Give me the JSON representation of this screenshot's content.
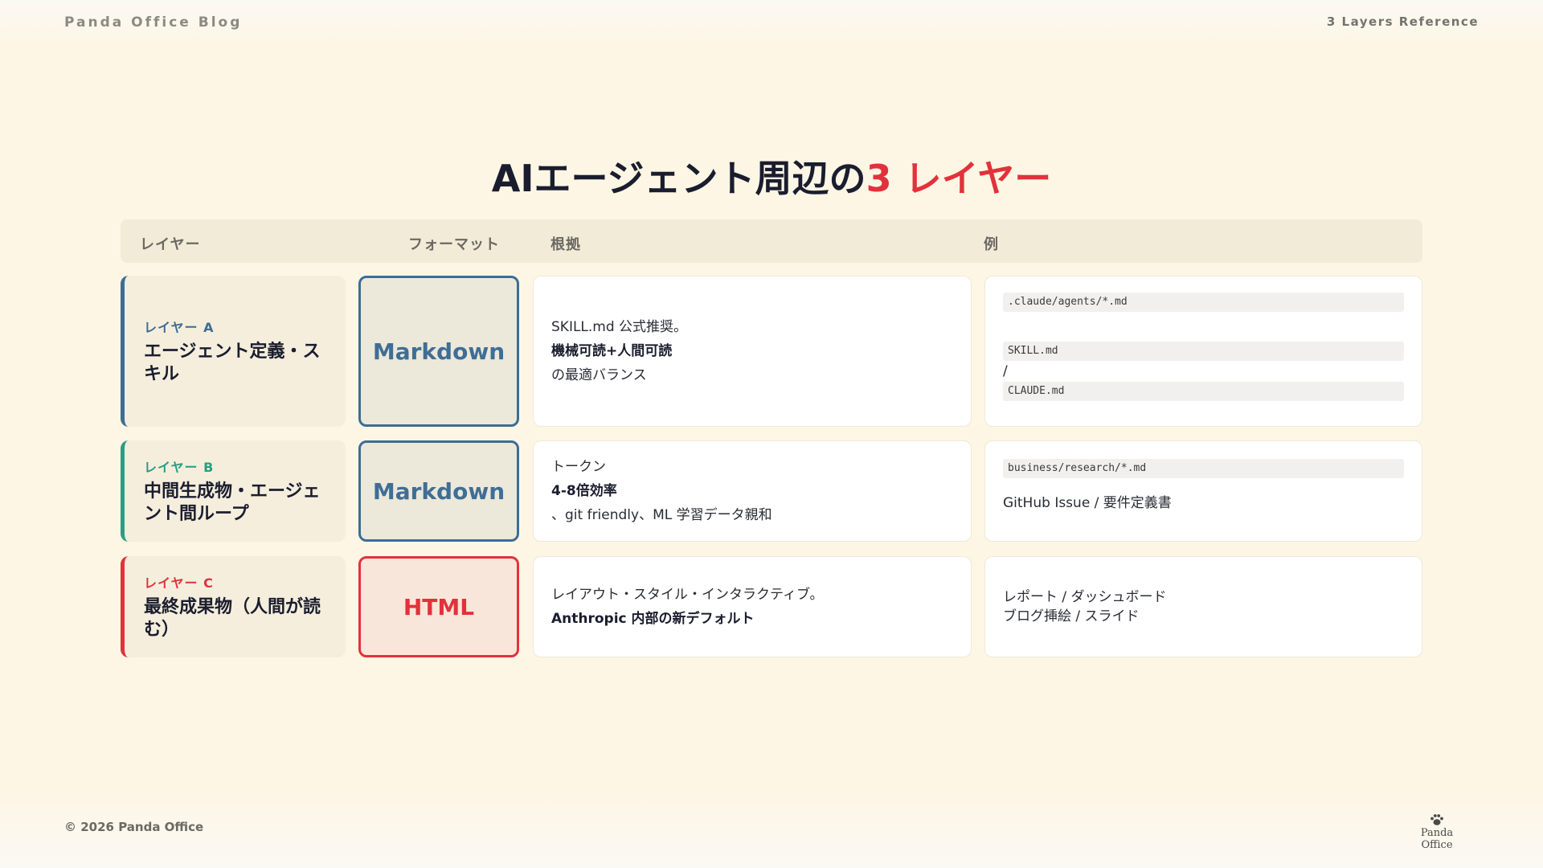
{
  "header": {
    "brand": "Panda Office Blog",
    "reference": "3 Layers Reference"
  },
  "title": {
    "main": "AIエージェント周辺の",
    "accent": "3 レイヤー"
  },
  "columns": {
    "layer": "レイヤー",
    "format": "フォーマット",
    "basis": "根拠",
    "example": "例"
  },
  "rows": [
    {
      "tag": "レイヤー A",
      "name": "エージェント定義・スキル",
      "format": "Markdown",
      "basis": [
        "SKILL.md 公式推奨。",
        "機械可読+人間可読",
        "の最適バランス"
      ],
      "examples": [
        ".claude/agents/*.md",
        "SKILL.md",
        "/",
        "CLAUDE.md"
      ]
    },
    {
      "tag": "レイヤー B",
      "name": "中間生成物・エージェント間ループ",
      "format": "Markdown",
      "basis": [
        "トークン",
        "4-8倍効率",
        "、git friendly、ML 学習データ親和"
      ],
      "examples": [
        "business/research/*.md",
        "GitHub Issue / 要件定義書"
      ]
    },
    {
      "tag": "レイヤー C",
      "name": "最終成果物（人間が読む）",
      "format": "HTML",
      "basis": [
        "レイアウト・スタイル・インタラクティブ。",
        "Anthropic 内部の新デフォルト"
      ],
      "examples": [
        "レポート / ダッシュボード",
        "ブログ挿絵 / スライド"
      ]
    }
  ],
  "footer": {
    "copyright": "© 2026 Panda Office",
    "logo": "Panda Office"
  },
  "colors": {
    "accent_red": "#e1323b",
    "layer_a": "#3d6d94",
    "layer_b": "#2a9d84",
    "layer_c": "#e1323b",
    "background": "#fdf6e4"
  }
}
